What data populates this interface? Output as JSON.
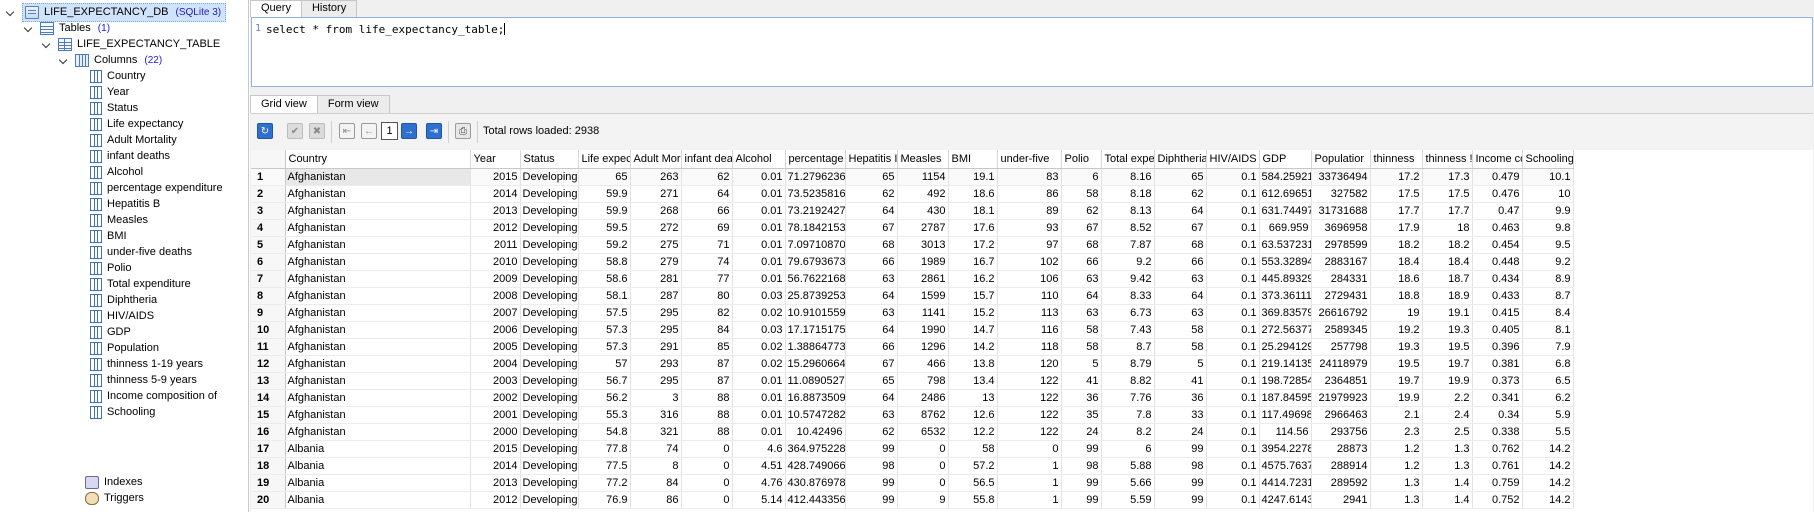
{
  "tree": {
    "database": {
      "name": "LIFE_EXPECTANCY_DB",
      "engine": "(SQLite 3)"
    },
    "tables": {
      "label": "Tables",
      "count": "(1)"
    },
    "table": {
      "name": "LIFE_EXPECTANCY_TABLE"
    },
    "columns": {
      "label": "Columns",
      "count": "(22)"
    },
    "column_items": [
      "Country",
      "Year",
      "Status",
      "Life expectancy",
      "Adult Mortality",
      "infant deaths",
      "Alcohol",
      "percentage expenditure",
      "Hepatitis B",
      "Measles",
      "BMI",
      "under-five deaths",
      "Polio",
      "Total expenditure",
      "Diphtheria",
      "HIV/AIDS",
      "GDP",
      "Population",
      "thinness  1-19 years",
      "thinness 5-9 years",
      "Income composition of",
      "Schooling"
    ],
    "indexes": "Indexes",
    "triggers": "Triggers"
  },
  "top_tabs": [
    "Query",
    "History"
  ],
  "editor": {
    "line_number": "1",
    "sql": "select * from life_expectancy_table;"
  },
  "result_tabs": [
    "Grid view",
    "Form view"
  ],
  "toolbar": {
    "page": "1",
    "total_rows": "Total rows loaded: 2938"
  },
  "grid": {
    "headers": [
      "Country",
      "Year",
      "Status",
      "Life expec",
      "Adult Mor",
      "infant dea",
      "Alcohol",
      "percentage",
      "Hepatitis I",
      "Measles",
      "BMI",
      "under-five",
      "Polio",
      "Total expe",
      "Diphtheria",
      "HIV/AIDS",
      "GDP",
      "Populatior",
      "thinness",
      "thinness !",
      "Income co",
      "Schooling"
    ],
    "rows": [
      [
        "1",
        "Afghanistan",
        "2015",
        "Developing",
        "65",
        "263",
        "62",
        "0.01",
        "71.27962362",
        "65",
        "1154",
        "19.1",
        "83",
        "6",
        "8.16",
        "65",
        "0.1",
        "584.25921",
        "33736494",
        "17.2",
        "17.3",
        "0.479",
        "10.1"
      ],
      [
        "2",
        "Afghanistan",
        "2014",
        "Developing",
        "59.9",
        "271",
        "64",
        "0.01",
        "73.52358168",
        "62",
        "492",
        "18.6",
        "86",
        "58",
        "8.18",
        "62",
        "0.1",
        "612.696514",
        "327582",
        "17.5",
        "17.5",
        "0.476",
        "10"
      ],
      [
        "3",
        "Afghanistan",
        "2013",
        "Developing",
        "59.9",
        "268",
        "66",
        "0.01",
        "73.21924272",
        "64",
        "430",
        "18.1",
        "89",
        "62",
        "8.13",
        "64",
        "0.1",
        "631.744976",
        "31731688",
        "17.7",
        "17.7",
        "0.47",
        "9.9"
      ],
      [
        "4",
        "Afghanistan",
        "2012",
        "Developing",
        "59.5",
        "272",
        "69",
        "0.01",
        "78.1842153",
        "67",
        "2787",
        "17.6",
        "93",
        "67",
        "8.52",
        "67",
        "0.1",
        "669.959",
        "3696958",
        "17.9",
        "18",
        "0.463",
        "9.8"
      ],
      [
        "5",
        "Afghanistan",
        "2011",
        "Developing",
        "59.2",
        "275",
        "71",
        "0.01",
        "7.097108703",
        "68",
        "3013",
        "17.2",
        "97",
        "68",
        "7.87",
        "68",
        "0.1",
        "63.537231",
        "2978599",
        "18.2",
        "18.2",
        "0.454",
        "9.5"
      ],
      [
        "6",
        "Afghanistan",
        "2010",
        "Developing",
        "58.8",
        "279",
        "74",
        "0.01",
        "79.67936736",
        "66",
        "1989",
        "16.7",
        "102",
        "66",
        "9.2",
        "66",
        "0.1",
        "553.32894",
        "2883167",
        "18.4",
        "18.4",
        "0.448",
        "9.2"
      ],
      [
        "7",
        "Afghanistan",
        "2009",
        "Developing",
        "58.6",
        "281",
        "77",
        "0.01",
        "56.76221682",
        "63",
        "2861",
        "16.2",
        "106",
        "63",
        "9.42",
        "63",
        "0.1",
        "445.8932979",
        "284331",
        "18.6",
        "18.7",
        "0.434",
        "8.9"
      ],
      [
        "8",
        "Afghanistan",
        "2008",
        "Developing",
        "58.1",
        "287",
        "80",
        "0.03",
        "25.87392536",
        "64",
        "1599",
        "15.7",
        "110",
        "64",
        "8.33",
        "64",
        "0.1",
        "373.3611163",
        "2729431",
        "18.8",
        "18.9",
        "0.433",
        "8.7"
      ],
      [
        "9",
        "Afghanistan",
        "2007",
        "Developing",
        "57.5",
        "295",
        "82",
        "0.02",
        "10.91015598",
        "63",
        "1141",
        "15.2",
        "113",
        "63",
        "6.73",
        "63",
        "0.1",
        "369.835796",
        "26616792",
        "19",
        "19.1",
        "0.415",
        "8.4"
      ],
      [
        "10",
        "Afghanistan",
        "2006",
        "Developing",
        "57.3",
        "295",
        "84",
        "0.03",
        "17.17151751",
        "64",
        "1990",
        "14.7",
        "116",
        "58",
        "7.43",
        "58",
        "0.1",
        "272.56377",
        "2589345",
        "19.2",
        "19.3",
        "0.405",
        "8.1"
      ],
      [
        "11",
        "Afghanistan",
        "2005",
        "Developing",
        "57.3",
        "291",
        "85",
        "0.02",
        "1.388647732",
        "66",
        "1296",
        "14.2",
        "118",
        "58",
        "8.7",
        "58",
        "0.1",
        "25.2941299",
        "257798",
        "19.3",
        "19.5",
        "0.396",
        "7.9"
      ],
      [
        "12",
        "Afghanistan",
        "2004",
        "Developing",
        "57",
        "293",
        "87",
        "0.02",
        "15.29606643",
        "67",
        "466",
        "13.8",
        "120",
        "5",
        "8.79",
        "5",
        "0.1",
        "219.1413528",
        "24118979",
        "19.5",
        "19.7",
        "0.381",
        "6.8"
      ],
      [
        "13",
        "Afghanistan",
        "2003",
        "Developing",
        "56.7",
        "295",
        "87",
        "0.01",
        "11.08905273",
        "65",
        "798",
        "13.4",
        "122",
        "41",
        "8.82",
        "41",
        "0.1",
        "198.7285436",
        "2364851",
        "19.7",
        "19.9",
        "0.373",
        "6.5"
      ],
      [
        "14",
        "Afghanistan",
        "2002",
        "Developing",
        "56.2",
        "3",
        "88",
        "0.01",
        "16.88735091",
        "64",
        "2486",
        "13",
        "122",
        "36",
        "7.76",
        "36",
        "0.1",
        "187.84595",
        "21979923",
        "19.9",
        "2.2",
        "0.341",
        "6.2"
      ],
      [
        "15",
        "Afghanistan",
        "2001",
        "Developing",
        "55.3",
        "316",
        "88",
        "0.01",
        "10.5747282",
        "63",
        "8762",
        "12.6",
        "122",
        "35",
        "7.8",
        "33",
        "0.1",
        "117.49698",
        "2966463",
        "2.1",
        "2.4",
        "0.34",
        "5.9"
      ],
      [
        "16",
        "Afghanistan",
        "2000",
        "Developing",
        "54.8",
        "321",
        "88",
        "0.01",
        "10.42496",
        "62",
        "6532",
        "12.2",
        "122",
        "24",
        "8.2",
        "24",
        "0.1",
        "114.56",
        "293756",
        "2.3",
        "2.5",
        "0.338",
        "5.5"
      ],
      [
        "17",
        "Albania",
        "2015",
        "Developing",
        "77.8",
        "74",
        "0",
        "4.6",
        "364.9752287",
        "99",
        "0",
        "58",
        "0",
        "99",
        "6",
        "99",
        "0.1",
        "3954.22783",
        "28873",
        "1.2",
        "1.3",
        "0.762",
        "14.2"
      ],
      [
        "18",
        "Albania",
        "2014",
        "Developing",
        "77.5",
        "8",
        "0",
        "4.51",
        "428.7490668",
        "98",
        "0",
        "57.2",
        "1",
        "98",
        "5.88",
        "98",
        "0.1",
        "4575.763787",
        "288914",
        "1.2",
        "1.3",
        "0.761",
        "14.2"
      ],
      [
        "19",
        "Albania",
        "2013",
        "Developing",
        "77.2",
        "84",
        "0",
        "4.76",
        "430.8769785",
        "99",
        "0",
        "56.5",
        "1",
        "99",
        "5.66",
        "99",
        "0.1",
        "4414.72314",
        "289592",
        "1.3",
        "1.4",
        "0.759",
        "14.2"
      ],
      [
        "20",
        "Albania",
        "2012",
        "Developing",
        "76.9",
        "86",
        "0",
        "5.14",
        "412.4433563",
        "99",
        "9",
        "55.8",
        "1",
        "99",
        "5.59",
        "99",
        "0.1",
        "4247.61438",
        "2941",
        "1.3",
        "1.4",
        "0.752",
        "14.2"
      ]
    ]
  },
  "icons": {
    "refresh": "refresh-icon",
    "commit": "check-icon",
    "rollback": "cancel-icon",
    "first": "first-page-icon",
    "prev": "prev-page-icon",
    "next": "next-page-icon",
    "last": "last-page-icon",
    "print": "print-icon"
  }
}
